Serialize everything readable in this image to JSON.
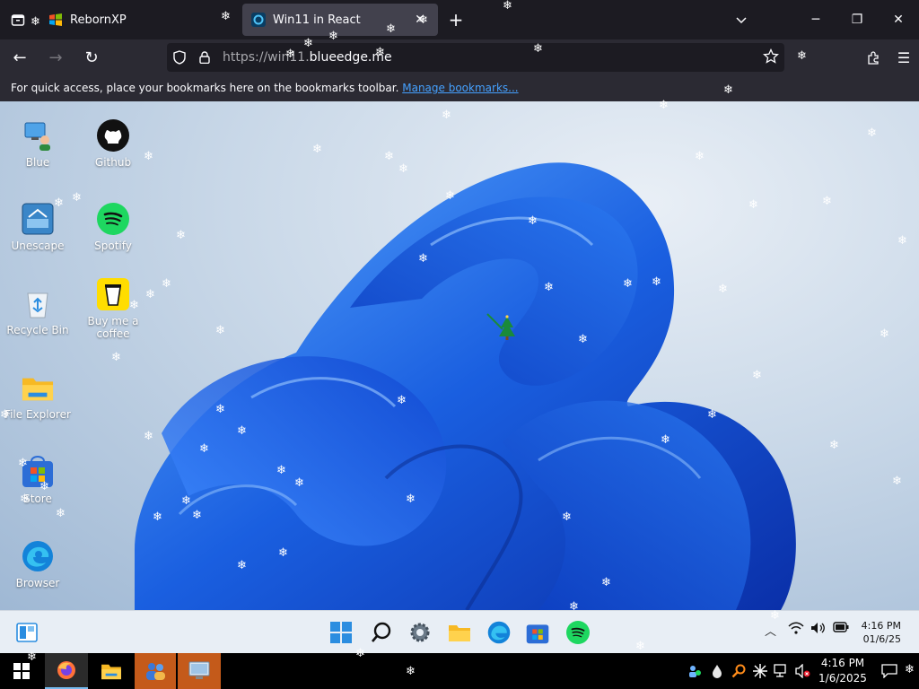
{
  "browser": {
    "tabs": [
      {
        "title": "RebornXP",
        "active": false
      },
      {
        "title": "Win11 in React",
        "active": true
      }
    ],
    "url_dim": "https://win11.",
    "url_host": "blueedge.me",
    "bookmarks_text": "For quick access, place your bookmarks here on the bookmarks toolbar.",
    "bookmarks_link": "Manage bookmarks..."
  },
  "desktop": {
    "icons": [
      {
        "label": "Blue",
        "icon": "user-pc-icon"
      },
      {
        "label": "Github",
        "icon": "github-icon"
      },
      {
        "label": "Unescape",
        "icon": "unescape-icon"
      },
      {
        "label": "Spotify",
        "icon": "spotify-icon"
      },
      {
        "label": "Recycle Bin",
        "icon": "recycle-bin-icon"
      },
      {
        "label": "Buy me a coffee",
        "icon": "coffee-icon"
      },
      {
        "label": "File Explorer",
        "icon": "folder-icon"
      },
      {
        "label": "Store",
        "icon": "store-icon"
      },
      {
        "label": "Browser",
        "icon": "edge-icon"
      }
    ]
  },
  "w11_taskbar": {
    "time": "4:16 PM",
    "date": "01/6/25"
  },
  "host_taskbar": {
    "time": "4:16 PM",
    "date": "1/6/2025"
  },
  "colors": {
    "accent": "#0067c0",
    "tab_active": "#42414d",
    "link": "#45a1ff",
    "bloom": "#1a5fe0"
  }
}
